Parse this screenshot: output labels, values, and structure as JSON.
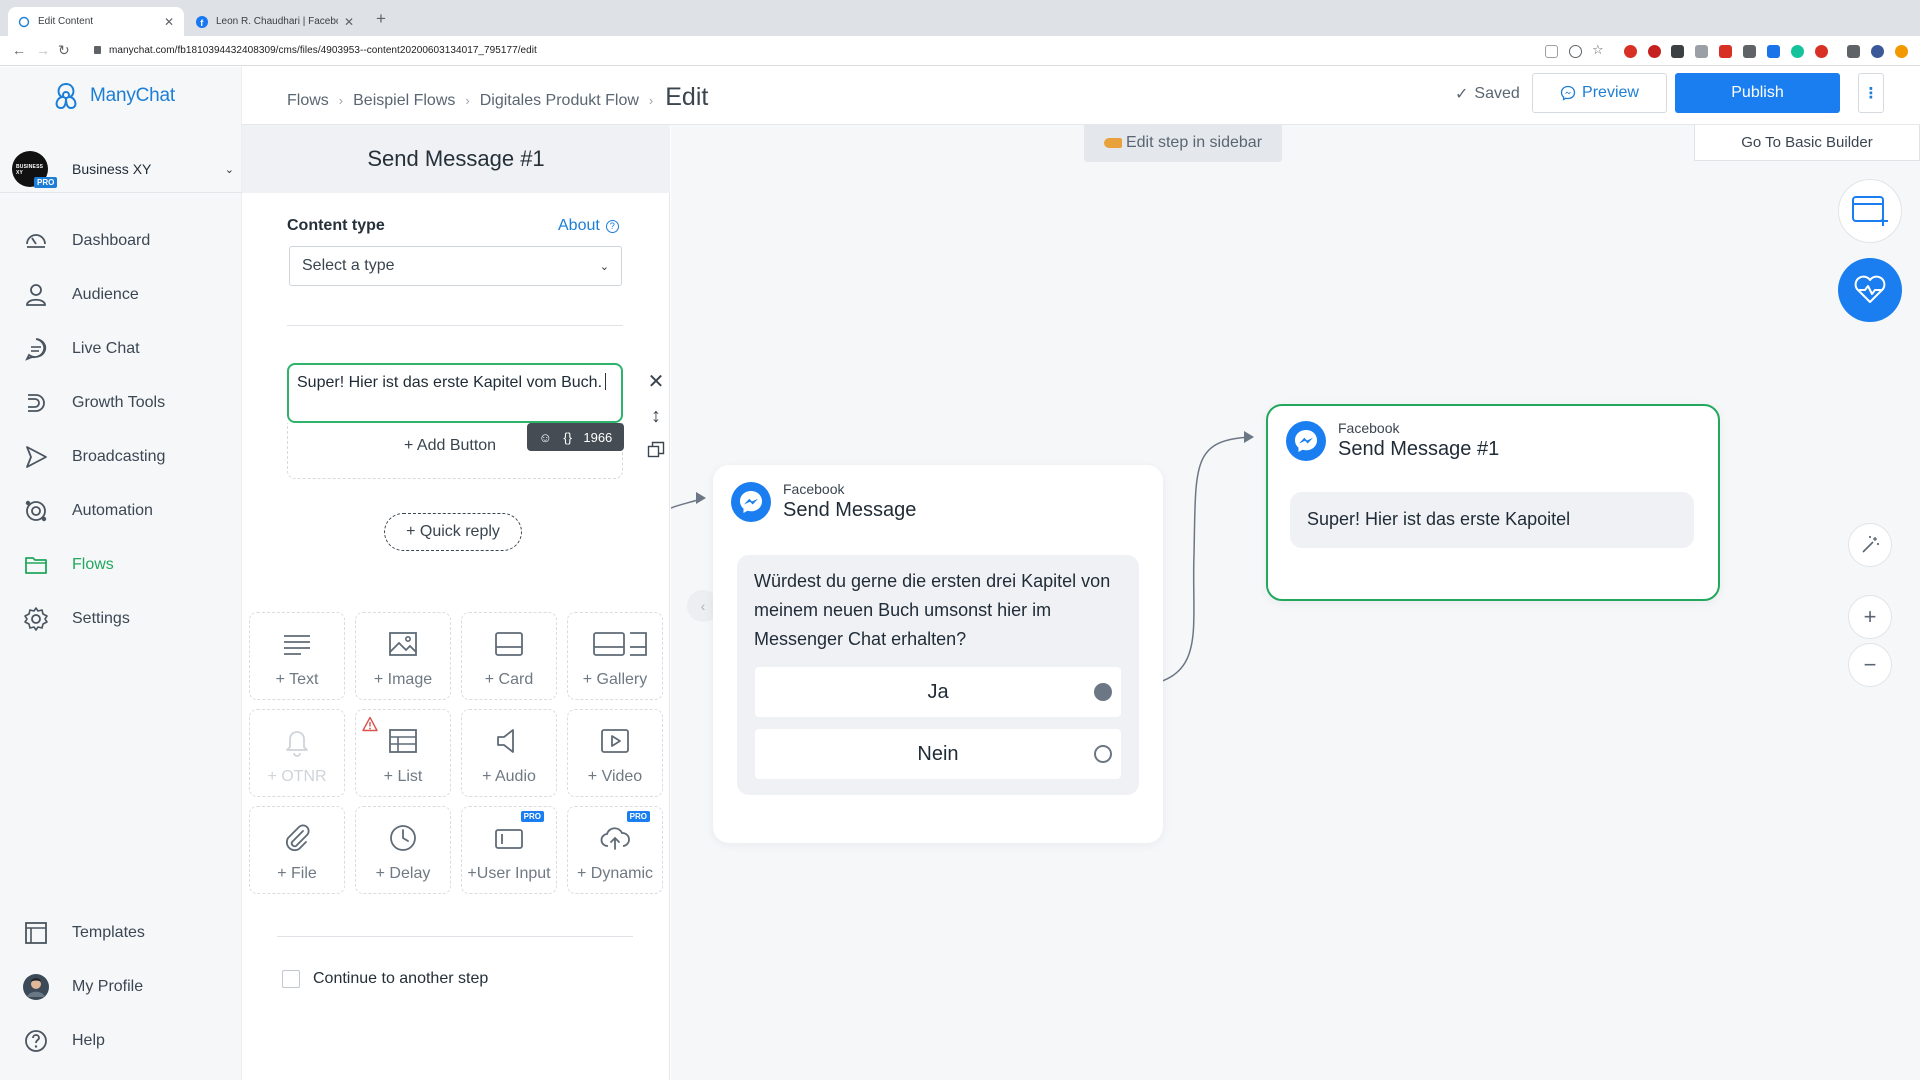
{
  "browser": {
    "tabs": [
      {
        "title": "Edit Content",
        "active": true
      },
      {
        "title": "Leon R. Chaudhari | Facebook",
        "active": false
      }
    ],
    "url": "manychat.com/fb181039443240830​9/cms/files/4903953--content20200603134017_795177/edit"
  },
  "app": {
    "logo_text": "ManyChat",
    "account": {
      "name": "Business XY",
      "avatar_text": "BUSINESS XY",
      "badge": "PRO"
    },
    "nav": [
      {
        "label": "Dashboard",
        "icon": "dashboard-icon"
      },
      {
        "label": "Audience",
        "icon": "person-icon"
      },
      {
        "label": "Live Chat",
        "icon": "chat-icon"
      },
      {
        "label": "Growth Tools",
        "icon": "growth-tools-icon"
      },
      {
        "label": "Broadcasting",
        "icon": "broadcast-icon"
      },
      {
        "label": "Automation",
        "icon": "automation-icon"
      },
      {
        "label": "Flows",
        "icon": "folder-icon",
        "active": true
      },
      {
        "label": "Settings",
        "icon": "gear-icon"
      }
    ],
    "nav_bottom": [
      {
        "label": "Templates",
        "icon": "templates-icon"
      },
      {
        "label": "My Profile",
        "icon": "avatar-icon"
      },
      {
        "label": "Help",
        "icon": "help-icon"
      }
    ],
    "active_color": "#22a75d",
    "accent_color": "#1a7ef0"
  },
  "header": {
    "breadcrumbs": [
      "Flows",
      "Beispiel Flows",
      "Digitales Produkt Flow"
    ],
    "current": "Edit",
    "saved_label": "Saved",
    "preview_label": "Preview",
    "publish_label": "Publish",
    "more_label": "⋮"
  },
  "panel": {
    "title": "Send Message #1",
    "content_type_label": "Content type",
    "about_label": "About",
    "select_placeholder": "Select a type",
    "message_text": "Super! Hier ist das erste Kapitel vom Buch.",
    "char_count": "1966",
    "add_button_label": "+ Add Button",
    "quick_reply_label": "+ Quick reply",
    "blocks": [
      {
        "label": "+ Text",
        "icon": "text-icon"
      },
      {
        "label": "+ Image",
        "icon": "image-icon"
      },
      {
        "label": "+ Card",
        "icon": "card-icon"
      },
      {
        "label": "+ Gallery",
        "icon": "gallery-icon"
      },
      {
        "label": "+ OTNR",
        "icon": "bell-icon",
        "disabled": true
      },
      {
        "label": "+ List",
        "icon": "list-icon",
        "warning": true
      },
      {
        "label": "+ Audio",
        "icon": "audio-icon"
      },
      {
        "label": "+ Video",
        "icon": "video-icon"
      },
      {
        "label": "+ File",
        "icon": "paperclip-icon"
      },
      {
        "label": "+ Delay",
        "icon": "clock-icon"
      },
      {
        "label": "+User Input",
        "icon": "user-input-icon",
        "pro": true
      },
      {
        "label": "+ Dynamic",
        "icon": "cloud-upload-icon",
        "pro": true
      }
    ],
    "pro_badge": "PRO",
    "continue_label": "Continue to another step"
  },
  "canvas": {
    "hint_label": "Edit step in sidebar",
    "basic_builder_label": "Go To Basic Builder",
    "node_send": {
      "platform": "Facebook",
      "title": "Send Message",
      "text": "Würdest du gerne die ersten drei Kapitel von meinem neuen Buch umsonst hier im Messenger Chat erhalten?",
      "buttons": [
        "Ja",
        "Nein"
      ]
    },
    "node_send1": {
      "platform": "Facebook",
      "title": "Send Message #1",
      "text": "Super! Hier ist das erste Kapoitel"
    },
    "zoom_in": "+",
    "zoom_out": "−"
  }
}
